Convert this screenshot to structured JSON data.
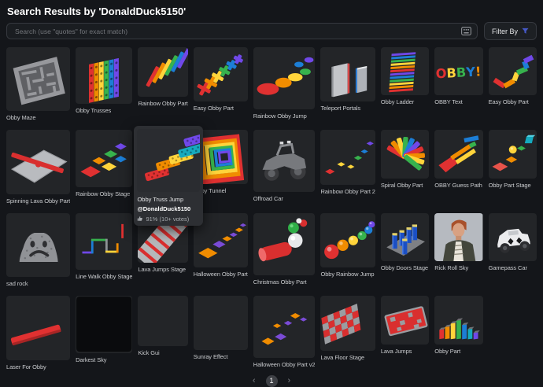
{
  "header": {
    "title": "Search Results by 'DonaldDuck5150'"
  },
  "search": {
    "placeholder": "Search (use \"quotes\" for exact match)",
    "icon": "keyboard-icon"
  },
  "filter": {
    "label": "Filter By",
    "icon": "filter-funnel-icon",
    "icon_color": "#4659c8"
  },
  "colors": {
    "page_bg": "#14161a",
    "tile_bg": "#232528",
    "hover_card_bg": "#2d2f33",
    "accent_blue": "#4659c8"
  },
  "grid": {
    "items": [
      {
        "label": "Obby Maze",
        "thumb": "maze"
      },
      {
        "label": "Obby Trusses",
        "thumb": "trussWall"
      },
      {
        "label": "Rainbow Obby Part",
        "thumb": "diagBars"
      },
      {
        "label": "Easy Obby Part",
        "thumb": "crosses"
      },
      {
        "label": "Rainbow Obby Jump",
        "thumb": "jumpPads"
      },
      {
        "label": "Teleport Portals",
        "thumb": "portals"
      },
      {
        "label": "Obby Ladder",
        "thumb": "ladder"
      },
      {
        "label": "OBBY Text",
        "thumb": "obbyText"
      },
      {
        "label": "Easy Obby Part",
        "thumb": "zigzag"
      },
      {
        "label": "Spinning Lava Obby Part",
        "thumb": "lavaSpinner"
      },
      {
        "label": "Rainbow Obby Stage",
        "thumb": "colorSquares"
      },
      {
        "label": "Obby Truss Jump",
        "thumb": "trussJump",
        "hovered": true
      },
      {
        "label": "Obby Tunnel",
        "thumb": "tunnel"
      },
      {
        "label": "Offroad Car",
        "thumb": "offroadCar"
      },
      {
        "label": "Rainbow Obby Part 2",
        "thumb": "smallDiamonds"
      },
      {
        "label": "Spiral Obby Part",
        "thumb": "spiral"
      },
      {
        "label": "OBBY Guess Path",
        "thumb": "guessPath"
      },
      {
        "label": "Obby Part Stage",
        "thumb": "shapesStage"
      },
      {
        "label": "sad rock",
        "thumb": "sadRock"
      },
      {
        "label": "Line Walk Obby Stage",
        "thumb": "lineWalk"
      },
      {
        "label": "Lava Jumps Stage",
        "thumb": "lavaRamp"
      },
      {
        "label": "Halloween Obby Part",
        "thumb": "halloween1"
      },
      {
        "label": "Christmas Obby Part",
        "thumb": "christmas"
      },
      {
        "label": "Obby Rainbow Jump",
        "thumb": "rainbowSpheres"
      },
      {
        "label": "Obby Doors Stage",
        "thumb": "doorsStage"
      },
      {
        "label": "Rick Roll Sky",
        "thumb": "rickRoll"
      },
      {
        "label": "Gamepass Car",
        "thumb": "gamepassCar"
      },
      {
        "label": "Laser For Obby",
        "thumb": "laser"
      },
      {
        "label": "Darkest Sky",
        "thumb": "darkSky"
      },
      {
        "label": "Kick Gui",
        "thumb": "blank"
      },
      {
        "label": "Sunray Effect",
        "thumb": "blank"
      },
      {
        "label": "Halloween Obby Part v2",
        "thumb": "halloween2"
      },
      {
        "label": "Lava Floor Stage",
        "thumb": "lavaChecker"
      },
      {
        "label": "Lava Jumps",
        "thumb": "lavaFloor"
      },
      {
        "label": "Obby Part",
        "thumb": "rainbowSteps"
      }
    ]
  },
  "hover_card": {
    "title": "Obby Truss Jump",
    "author": "@DonaldDuck5150",
    "rating_icon": "thumbs-up-icon",
    "rating": "91% (10+ votes)"
  },
  "pagination": {
    "prev": "‹",
    "current": "1",
    "next": "›"
  }
}
